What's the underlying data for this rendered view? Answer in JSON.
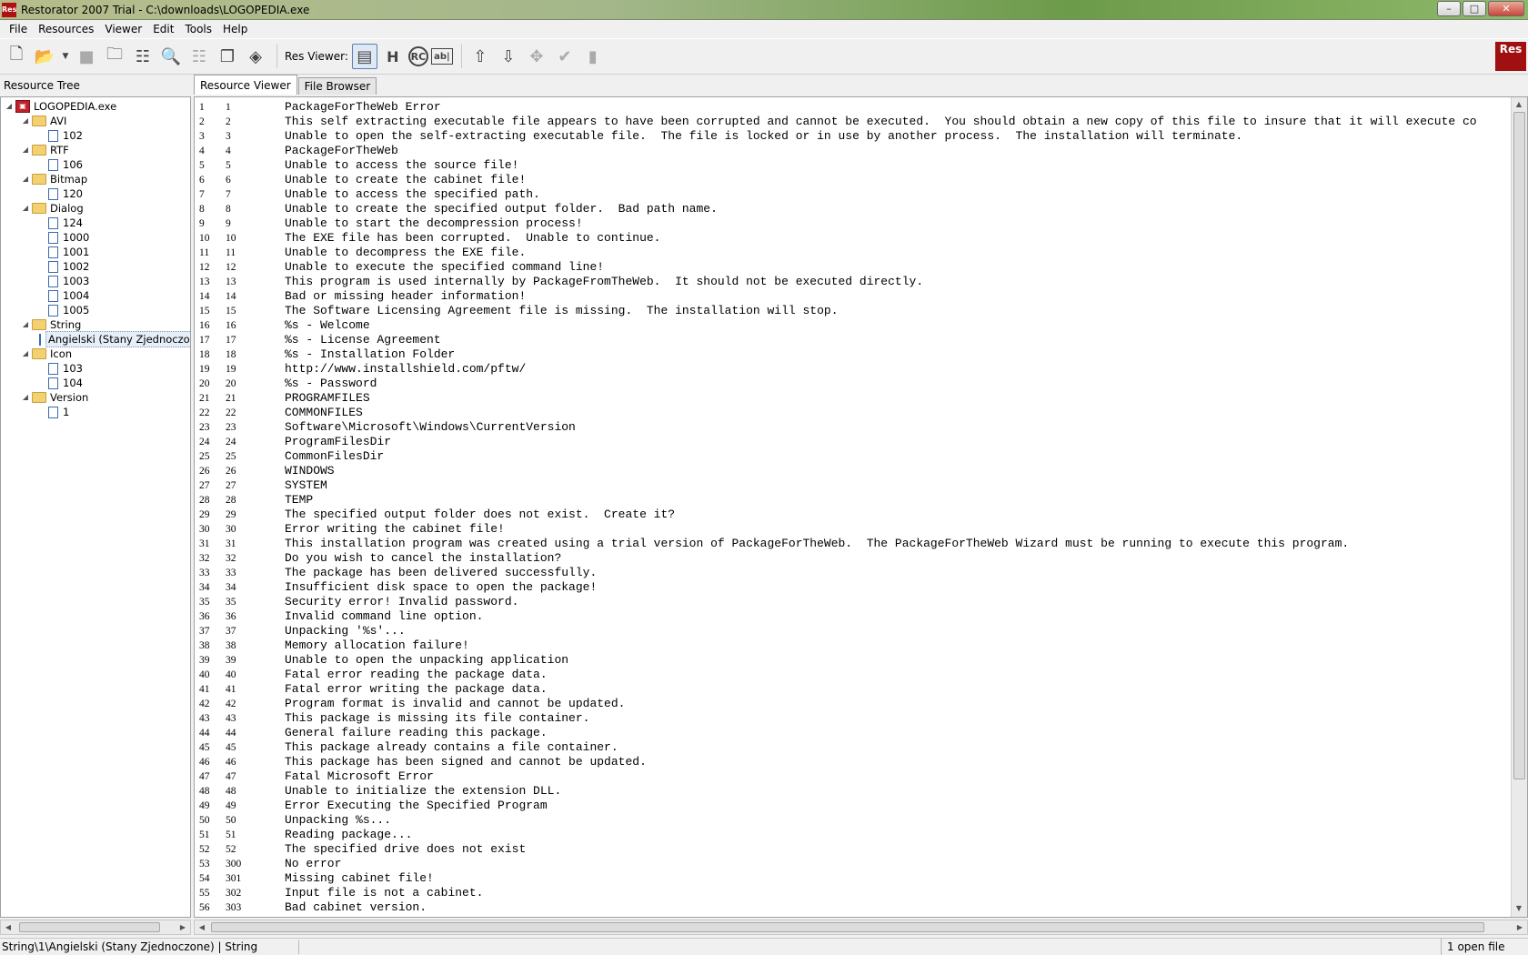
{
  "window": {
    "title": "Restorator 2007 Trial - C:\\downloads\\LOGOPEDIA.exe",
    "app_icon_text": "Res",
    "minimize": "–",
    "maximize": "□",
    "close": "✕"
  },
  "menu": [
    "File",
    "Resources",
    "Viewer",
    "Edit",
    "Tools",
    "Help"
  ],
  "toolbar": {
    "res_viewer_label": "Res Viewer:",
    "logo_text": "Res"
  },
  "left_panel": {
    "header": "Resource Tree"
  },
  "tree": [
    {
      "label": "LOGOPEDIA.exe",
      "level": 0,
      "kind": "exe",
      "expanded": true
    },
    {
      "label": "AVI",
      "level": 1,
      "kind": "folder",
      "expanded": true
    },
    {
      "label": "102",
      "level": 2,
      "kind": "page"
    },
    {
      "label": "RTF",
      "level": 1,
      "kind": "folder",
      "expanded": true
    },
    {
      "label": "106",
      "level": 2,
      "kind": "page"
    },
    {
      "label": "Bitmap",
      "level": 1,
      "kind": "folder",
      "expanded": true
    },
    {
      "label": "120",
      "level": 2,
      "kind": "page"
    },
    {
      "label": "Dialog",
      "level": 1,
      "kind": "folder",
      "expanded": true
    },
    {
      "label": "124",
      "level": 2,
      "kind": "page"
    },
    {
      "label": "1000",
      "level": 2,
      "kind": "page"
    },
    {
      "label": "1001",
      "level": 2,
      "kind": "page"
    },
    {
      "label": "1002",
      "level": 2,
      "kind": "page"
    },
    {
      "label": "1003",
      "level": 2,
      "kind": "page"
    },
    {
      "label": "1004",
      "level": 2,
      "kind": "page"
    },
    {
      "label": "1005",
      "level": 2,
      "kind": "page"
    },
    {
      "label": "String",
      "level": 1,
      "kind": "folder",
      "expanded": true
    },
    {
      "label": "Angielski (Stany Zjednoczone)",
      "level": 2,
      "kind": "page",
      "selected": true
    },
    {
      "label": "Icon",
      "level": 1,
      "kind": "folder",
      "expanded": true
    },
    {
      "label": "103",
      "level": 2,
      "kind": "page"
    },
    {
      "label": "104",
      "level": 2,
      "kind": "page"
    },
    {
      "label": "Version",
      "level": 1,
      "kind": "folder",
      "expanded": true
    },
    {
      "label": "1",
      "level": 2,
      "kind": "page"
    }
  ],
  "tabs": [
    {
      "label": "Resource Viewer",
      "active": true
    },
    {
      "label": "File Browser",
      "active": false
    }
  ],
  "strings": [
    [
      "1",
      "1",
      "PackageForTheWeb Error"
    ],
    [
      "2",
      "2",
      "This self extracting executable file appears to have been corrupted and cannot be executed.  You should obtain a new copy of this file to insure that it will execute co"
    ],
    [
      "3",
      "3",
      "Unable to open the self-extracting executable file.  The file is locked or in use by another process.  The installation will terminate."
    ],
    [
      "4",
      "4",
      "PackageForTheWeb"
    ],
    [
      "5",
      "5",
      "Unable to access the source file!"
    ],
    [
      "6",
      "6",
      "Unable to create the cabinet file!"
    ],
    [
      "7",
      "7",
      "Unable to access the specified path."
    ],
    [
      "8",
      "8",
      "Unable to create the specified output folder.  Bad path name."
    ],
    [
      "9",
      "9",
      "Unable to start the decompression process!"
    ],
    [
      "10",
      "10",
      "The EXE file has been corrupted.  Unable to continue."
    ],
    [
      "11",
      "11",
      "Unable to decompress the EXE file."
    ],
    [
      "12",
      "12",
      "Unable to execute the specified command line!"
    ],
    [
      "13",
      "13",
      "This program is used internally by PackageFromTheWeb.  It should not be executed directly."
    ],
    [
      "14",
      "14",
      "Bad or missing header information!"
    ],
    [
      "15",
      "15",
      "The Software Licensing Agreement file is missing.  The installation will stop."
    ],
    [
      "16",
      "16",
      "%s - Welcome"
    ],
    [
      "17",
      "17",
      "%s - License Agreement"
    ],
    [
      "18",
      "18",
      "%s - Installation Folder"
    ],
    [
      "19",
      "19",
      "http://www.installshield.com/pftw/"
    ],
    [
      "20",
      "20",
      "%s - Password"
    ],
    [
      "21",
      "21",
      "PROGRAMFILES"
    ],
    [
      "22",
      "22",
      "COMMONFILES"
    ],
    [
      "23",
      "23",
      "Software\\Microsoft\\Windows\\CurrentVersion"
    ],
    [
      "24",
      "24",
      "ProgramFilesDir"
    ],
    [
      "25",
      "25",
      "CommonFilesDir"
    ],
    [
      "26",
      "26",
      "WINDOWS"
    ],
    [
      "27",
      "27",
      "SYSTEM"
    ],
    [
      "28",
      "28",
      "TEMP"
    ],
    [
      "29",
      "29",
      "The specified output folder does not exist.  Create it?"
    ],
    [
      "30",
      "30",
      "Error writing the cabinet file!"
    ],
    [
      "31",
      "31",
      "This installation program was created using a trial version of PackageForTheWeb.  The PackageForTheWeb Wizard must be running to execute this program."
    ],
    [
      "32",
      "32",
      "Do you wish to cancel the installation?"
    ],
    [
      "33",
      "33",
      "The package has been delivered successfully."
    ],
    [
      "34",
      "34",
      "Insufficient disk space to open the package!"
    ],
    [
      "35",
      "35",
      "Security error! Invalid password."
    ],
    [
      "36",
      "36",
      "Invalid command line option."
    ],
    [
      "37",
      "37",
      "Unpacking '%s'..."
    ],
    [
      "38",
      "38",
      "Memory allocation failure!"
    ],
    [
      "39",
      "39",
      "Unable to open the unpacking application"
    ],
    [
      "40",
      "40",
      "Fatal error reading the package data."
    ],
    [
      "41",
      "41",
      "Fatal error writing the package data."
    ],
    [
      "42",
      "42",
      "Program format is invalid and cannot be updated."
    ],
    [
      "43",
      "43",
      "This package is missing its file container."
    ],
    [
      "44",
      "44",
      "General failure reading this package."
    ],
    [
      "45",
      "45",
      "This package already contains a file container."
    ],
    [
      "46",
      "46",
      "This package has been signed and cannot be updated."
    ],
    [
      "47",
      "47",
      "Fatal Microsoft Error"
    ],
    [
      "48",
      "48",
      "Unable to initialize the extension DLL."
    ],
    [
      "49",
      "49",
      "Error Executing the Specified Program"
    ],
    [
      "50",
      "50",
      "Unpacking %s..."
    ],
    [
      "51",
      "51",
      "Reading package..."
    ],
    [
      "52",
      "52",
      "The specified drive does not exist"
    ],
    [
      "53",
      "300",
      "No error"
    ],
    [
      "54",
      "301",
      "Missing cabinet file!"
    ],
    [
      "55",
      "302",
      "Input file is not a cabinet."
    ],
    [
      "56",
      "303",
      "Bad cabinet version."
    ]
  ],
  "status": {
    "path": "String\\1\\Angielski (Stany Zjednoczone)",
    "type": "String",
    "files": "1 open file"
  }
}
